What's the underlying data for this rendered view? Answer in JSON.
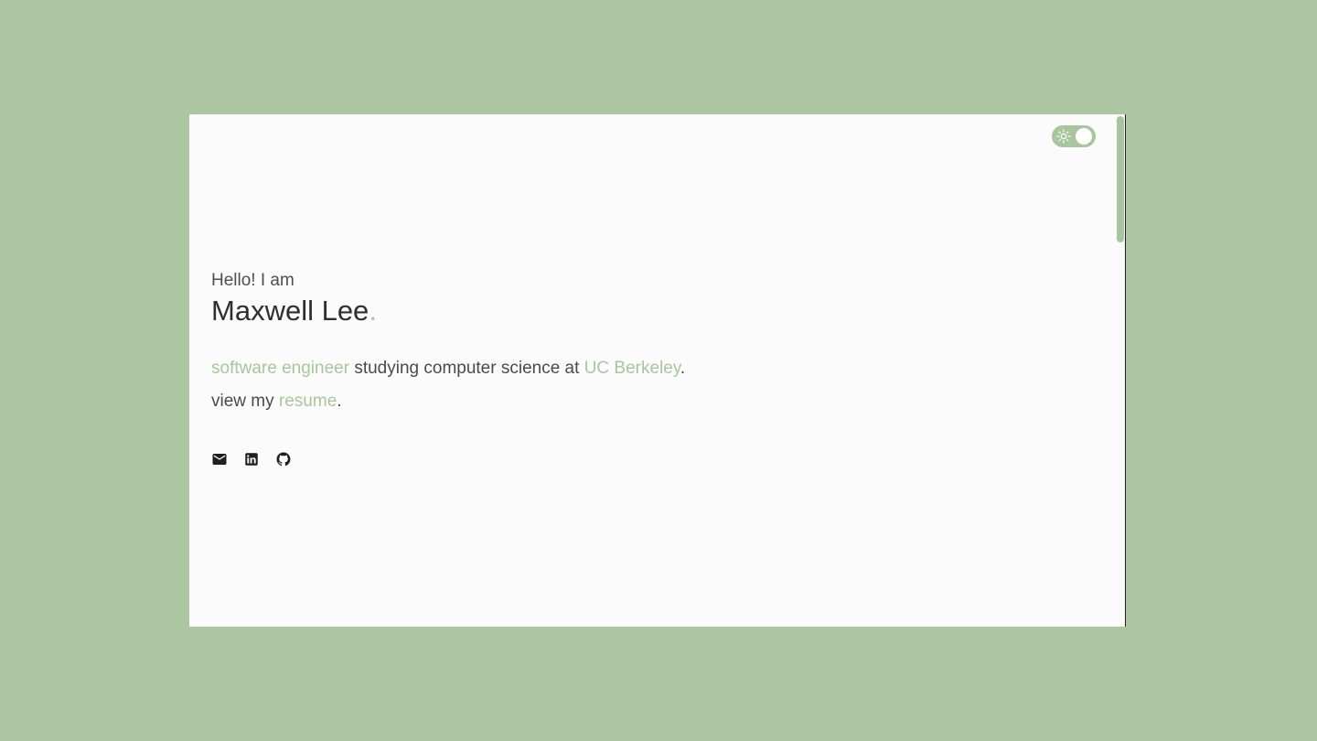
{
  "hero": {
    "greeting": "Hello! I am",
    "name": "Maxwell Lee",
    "name_dot": "."
  },
  "bio": {
    "role_link": "software engineer",
    "role_middle": " studying computer science at ",
    "school_link": "UC Berkeley",
    "line1_end": ".",
    "resume_prefix": "view my ",
    "resume_link": "resume",
    "line2_end": "."
  },
  "social": {
    "icons": [
      "mail-icon",
      "linkedin-icon",
      "github-icon"
    ]
  },
  "theme_toggle": {
    "icon": "sun-icon",
    "state": "light"
  },
  "colors": {
    "accent": "#a9c59f",
    "page_background": "#abc6a1",
    "window_background": "#fbfbfb",
    "text": "#4a4a4a"
  }
}
